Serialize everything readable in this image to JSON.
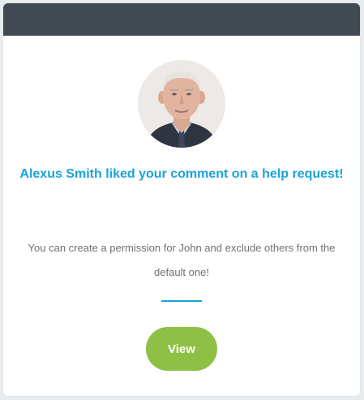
{
  "notification": {
    "headline": "Alexus Smith liked your comment on a help request!",
    "message": "You can create a permission for John and exclude others from the default one!",
    "action_label": "View"
  },
  "colors": {
    "header": "#414a52",
    "accent": "#1aa3d9",
    "button": "#8dc045",
    "body_text": "#707070"
  }
}
